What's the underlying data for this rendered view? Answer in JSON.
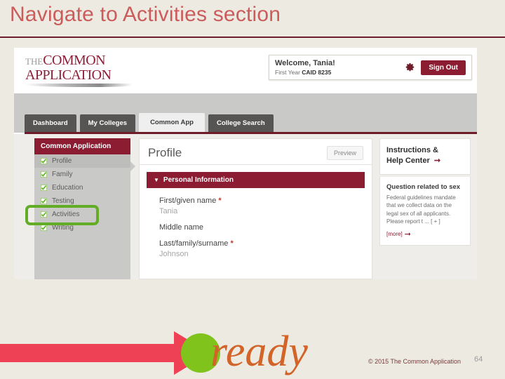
{
  "slide": {
    "title": "Navigate to Activities section",
    "title_color": "#cc5b5b",
    "accent_color": "#6e1b2a",
    "background": "#edeae1"
  },
  "screenshot": {
    "logo": {
      "the": "THE",
      "line1": "COMMON",
      "line2": "APPLICATION"
    },
    "welcome": {
      "name": "Welcome, Tania!",
      "year": "First Year",
      "caid": "CAID 8235",
      "gear_icon": "gear-icon",
      "sign_out_label": "Sign Out",
      "sign_out_color": "#8b1c32"
    },
    "tabs": [
      {
        "label": "Dashboard",
        "active": false
      },
      {
        "label": "My Colleges",
        "active": false
      },
      {
        "label": "Common App",
        "active": true
      },
      {
        "label": "College Search",
        "active": false
      }
    ],
    "sidebar": {
      "title": "Common Application",
      "items": [
        {
          "label": "Profile",
          "selected": true
        },
        {
          "label": "Family",
          "selected": false
        },
        {
          "label": "Education",
          "selected": false
        },
        {
          "label": "Testing",
          "selected": false
        },
        {
          "label": "Activities",
          "selected": false,
          "highlighted": true
        },
        {
          "label": "Writing",
          "selected": false
        }
      ],
      "highlight_color": "#62ad25"
    },
    "main": {
      "title": "Profile",
      "preview_label": "Preview",
      "section": {
        "label": "Personal Information",
        "caret": "▼",
        "color": "#8b1c32"
      },
      "fields": [
        {
          "label": "First/given name",
          "required": true,
          "value": "Tania"
        },
        {
          "label": "Middle name",
          "required": false,
          "value": ""
        },
        {
          "label": "Last/family/surname",
          "required": true,
          "value": "Johnson"
        }
      ]
    },
    "help": {
      "heading_line1": "Instructions &",
      "heading_line2": "Help Center",
      "heading_arrow": "arrow-icon",
      "question_title": "Question related to sex",
      "question_text": "Federal guidelines mandate that we collect data on the legal sex of all applicants. Please report t ... [ + ]",
      "more_label": "[more]",
      "more_arrow": "arrow-icon"
    }
  },
  "footer": {
    "ready_word": "ready",
    "arrow_color": "#ef4155",
    "circle_color": "#80c31c",
    "word_color": "#d2642a",
    "copyright": "© 2015 The Common Application",
    "page_number": "64"
  }
}
